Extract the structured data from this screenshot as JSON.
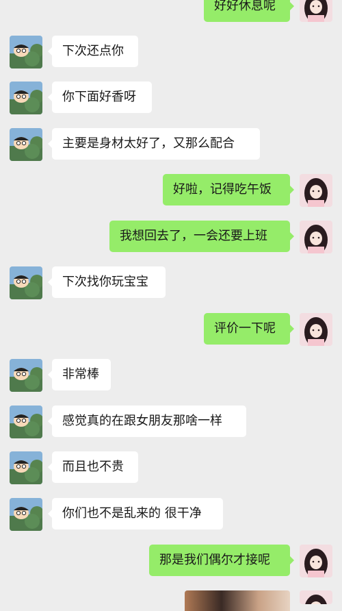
{
  "messages": [
    {
      "side": "out",
      "text": "好好休息呢"
    },
    {
      "side": "in",
      "text": "下次还点你"
    },
    {
      "side": "in",
      "text": "你下面好香呀"
    },
    {
      "side": "in",
      "text": "主要是身材太好了，又那么配合"
    },
    {
      "side": "out",
      "text": "好啦，记得吃午饭"
    },
    {
      "side": "out",
      "text": "我想回去了，一会还要上班"
    },
    {
      "side": "in",
      "text": "下次找你玩宝宝"
    },
    {
      "side": "out",
      "text": "评价一下呢"
    },
    {
      "side": "in",
      "text": "非常棒"
    },
    {
      "side": "in",
      "text": "感觉真的在跟女朋友那啥一样"
    },
    {
      "side": "in",
      "text": "而且也不贵"
    },
    {
      "side": "in",
      "text": "你们也不是乱来的 很干净"
    },
    {
      "side": "out",
      "text": "那是我们偶尔才接呢"
    }
  ],
  "avatars": {
    "contact": "crayon-shinchan-avatar",
    "self": "cartoon-girl-avatar"
  },
  "colors": {
    "background": "#ededed",
    "incoming_bubble": "#ffffff",
    "outgoing_bubble": "#95ec69"
  }
}
